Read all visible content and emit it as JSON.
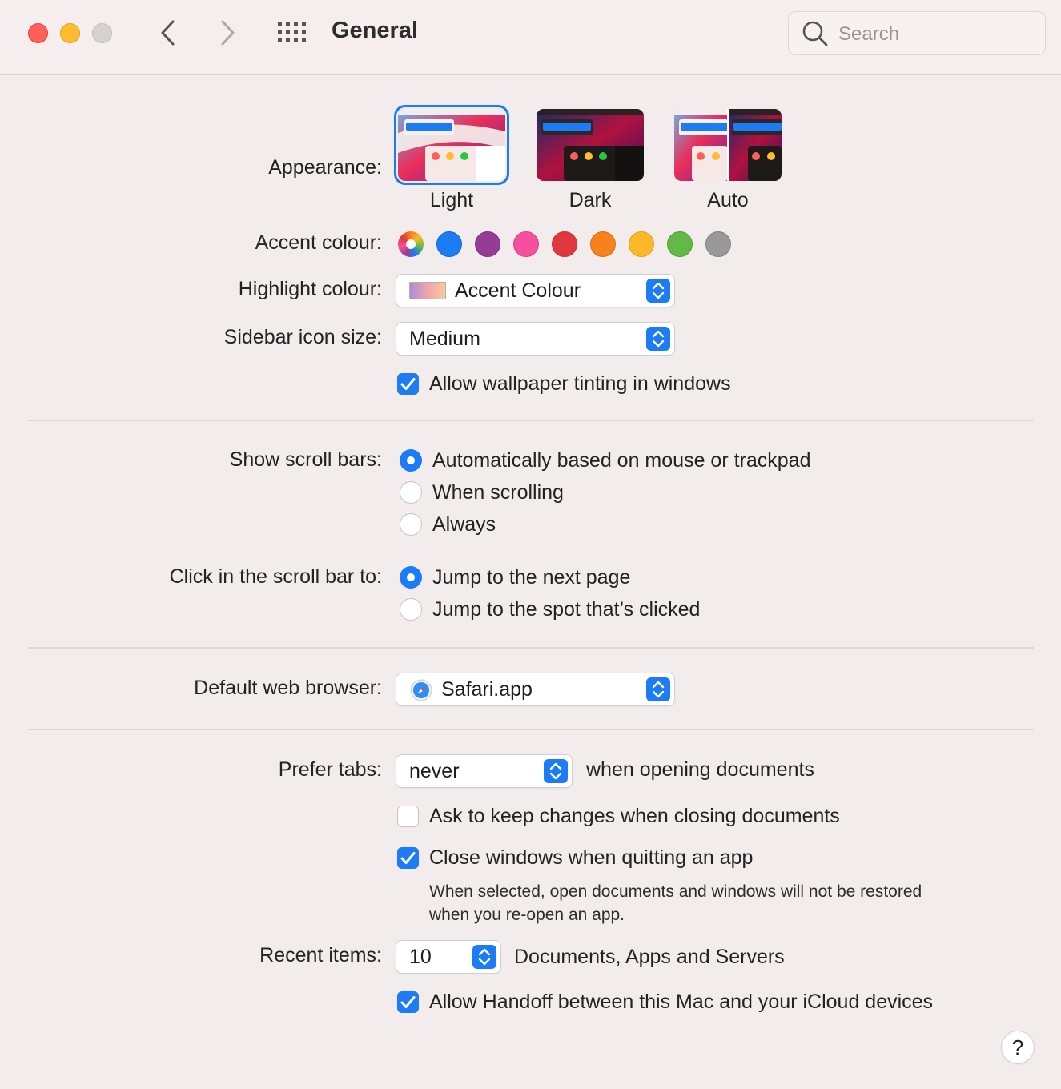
{
  "window": {
    "title": "General",
    "search_placeholder": "Search"
  },
  "appearance": {
    "label": "Appearance:",
    "options": [
      {
        "name": "Light",
        "selected": true
      },
      {
        "name": "Dark",
        "selected": false
      },
      {
        "name": "Auto",
        "selected": false
      }
    ]
  },
  "accent": {
    "label": "Accent colour:",
    "colors": [
      "multicolor",
      "#1b7cf5",
      "#953d96",
      "#f74f9e",
      "#e0383e",
      "#f7821b",
      "#fcb827",
      "#62ba46",
      "#989898"
    ],
    "selected_index": 0
  },
  "highlight": {
    "label": "Highlight colour:",
    "value": "Accent Colour"
  },
  "sidebar": {
    "label": "Sidebar icon size:",
    "value": "Medium"
  },
  "wallpaper_tinting": {
    "label": "Allow wallpaper tinting in windows",
    "checked": true
  },
  "scroll_bars": {
    "label": "Show scroll bars:",
    "options": [
      "Automatically based on mouse or trackpad",
      "When scrolling",
      "Always"
    ],
    "selected_index": 0
  },
  "click_scroll": {
    "label": "Click in the scroll bar to:",
    "options": [
      "Jump to the next page",
      "Jump to the spot that’s clicked"
    ],
    "selected_index": 0
  },
  "browser": {
    "label": "Default web browser:",
    "value": "Safari.app"
  },
  "tabs": {
    "label": "Prefer tabs:",
    "value": "never",
    "suffix": "when opening documents"
  },
  "ask_keep": {
    "label": "Ask to keep changes when closing documents",
    "checked": false
  },
  "close_windows": {
    "label": "Close windows when quitting an app",
    "checked": true,
    "note_line1": "When selected, open documents and windows will not be restored",
    "note_line2": "when you re-open an app."
  },
  "recent": {
    "label": "Recent items:",
    "value": "10",
    "suffix": "Documents, Apps and Servers"
  },
  "handoff": {
    "label": "Allow Handoff between this Mac and your iCloud devices",
    "checked": true
  },
  "help": {
    "label": "?"
  }
}
